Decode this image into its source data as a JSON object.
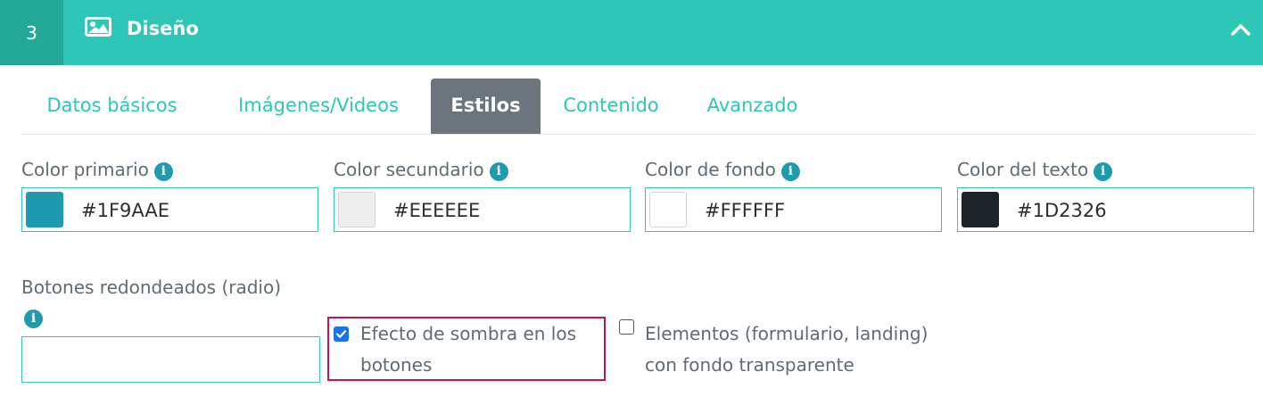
{
  "header": {
    "step_number": "3",
    "title": "Diseño",
    "icon": "image-icon",
    "collapse_icon": "chevron-up-icon",
    "bg_color": "#2ec6b6"
  },
  "tabs": [
    {
      "label": "Datos básicos",
      "active": false
    },
    {
      "label": "Imágenes/Videos",
      "active": false
    },
    {
      "label": "Estilos",
      "active": true
    },
    {
      "label": "Contenido",
      "active": false
    },
    {
      "label": "Avanzado",
      "active": false
    }
  ],
  "colors": [
    {
      "label": "Color primario",
      "value": "#1F9AAE",
      "swatch": "#1F9AAE"
    },
    {
      "label": "Color secundario",
      "value": "#EEEEEE",
      "swatch": "#EEEEEE"
    },
    {
      "label": "Color de fondo",
      "value": "#FFFFFF",
      "swatch": "#FFFFFF"
    },
    {
      "label": "Color del texto",
      "value": "#1D2326",
      "swatch": "#1D2326"
    }
  ],
  "radius": {
    "label": "Botones redondeados (radio)",
    "value": ""
  },
  "options": {
    "shadow": {
      "line1": "Efecto de sombra en los",
      "line2": "botones",
      "checked": true
    },
    "transparent": {
      "line1": "Elementos (formulario, landing)",
      "line2": "con fondo transparente",
      "checked": false
    }
  },
  "info_icon_glyph": "i"
}
